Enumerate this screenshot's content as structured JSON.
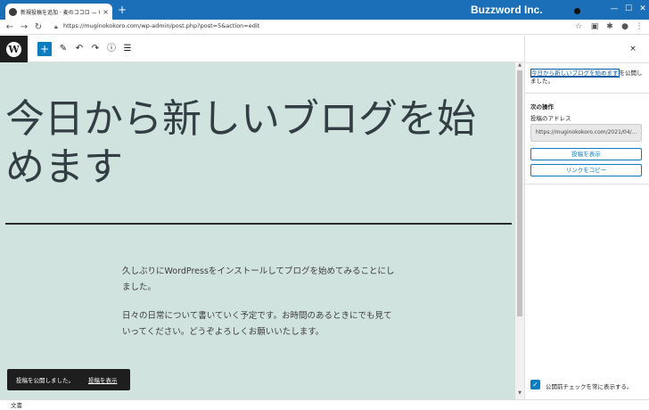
{
  "browser": {
    "tab_title": "新規投稿を追加 · 麦のココロ — W",
    "tab_close": "×",
    "new_tab": "+",
    "brand": "Buzzword Inc.",
    "window_controls": [
      "—",
      "☐",
      "✕"
    ],
    "url": "https://muginokokoro.com/wp-admin/post.php?post=5&action=edit",
    "icons": [
      "back-arrow-icon",
      "forward-arrow-icon",
      "reload-icon",
      "star-icon",
      "extension-icon",
      "puzzle-icon",
      "profile-icon",
      "more-icon"
    ]
  },
  "wp_toolbar": {
    "logo": "W",
    "add_block": "+",
    "tools": [
      "✎",
      "↶",
      "↷",
      "ⓘ",
      "☰"
    ]
  },
  "post": {
    "title": "今日から新しいブログを始めます",
    "paragraph1": "久しぶりにWordPressをインストールしてブログを始めてみることにしました。",
    "paragraph2": "日々の日常について書いていく予定です。お時間のあるときにでも見ていってください。どうぞよろしくお願いいたします。"
  },
  "snackbar": {
    "message": "投稿を公開しました。",
    "action": "投稿を表示"
  },
  "sidebar": {
    "close": "×",
    "published_link": "今日から新しいブログを始めます",
    "published_suffix": "を公開しました。",
    "next_steps": "次の操作",
    "post_address_label": "投稿のアドレス",
    "post_address_value": "https://muginokokoro.com/2021/04/...",
    "view_post_button": "投稿を表示",
    "copy_link_button": "リンクをコピー",
    "precheck_label": "公開前チェックを常に表示する。",
    "precheck_checked": true
  },
  "statusbar": {
    "text": "文書"
  },
  "colors": {
    "browser_chrome": "#1b6fb8",
    "canvas_bg": "#d1e3de",
    "wp_blue": "#0a7dc1",
    "snackbar_bg": "#1e1e1e"
  }
}
